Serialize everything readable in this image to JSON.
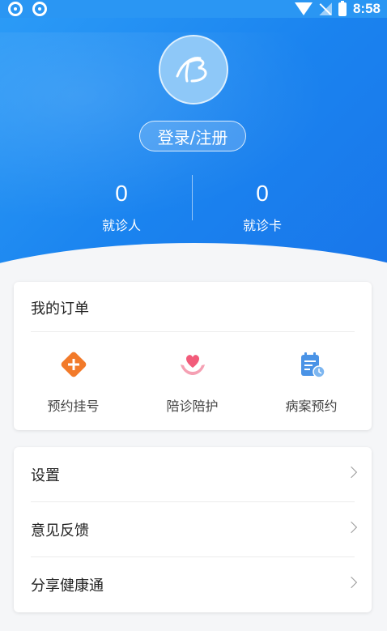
{
  "status_bar": {
    "time": "8:58"
  },
  "header": {
    "login_label": "登录/注册",
    "stats": [
      {
        "value": "0",
        "label": "就诊人"
      },
      {
        "value": "0",
        "label": "就诊卡"
      }
    ]
  },
  "orders": {
    "title": "我的订单",
    "items": [
      {
        "label": "预约挂号",
        "icon": "appointment-icon"
      },
      {
        "label": "陪诊陪护",
        "icon": "care-icon"
      },
      {
        "label": "病案预约",
        "icon": "medical-record-icon"
      }
    ]
  },
  "menu": {
    "items": [
      {
        "label": "设置"
      },
      {
        "label": "意见反馈"
      },
      {
        "label": "分享健康通"
      }
    ]
  },
  "colors": {
    "header_blue": "#1a83ef",
    "appointment_orange": "#f27a2a",
    "care_pink": "#f25b7a",
    "record_blue": "#4a93e6"
  }
}
